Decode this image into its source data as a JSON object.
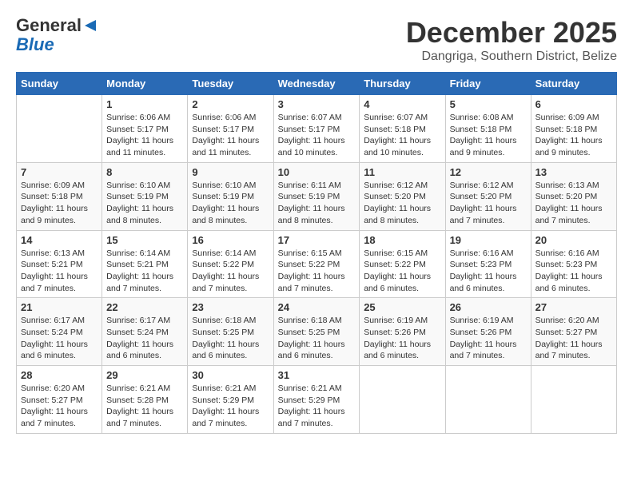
{
  "header": {
    "logo_general": "General",
    "logo_blue": "Blue",
    "month_title": "December 2025",
    "location": "Dangriga, Southern District, Belize"
  },
  "days_of_week": [
    "Sunday",
    "Monday",
    "Tuesday",
    "Wednesday",
    "Thursday",
    "Friday",
    "Saturday"
  ],
  "weeks": [
    [
      {
        "day": "",
        "sunrise": "",
        "sunset": "",
        "daylight": ""
      },
      {
        "day": "1",
        "sunrise": "Sunrise: 6:06 AM",
        "sunset": "Sunset: 5:17 PM",
        "daylight": "Daylight: 11 hours and 11 minutes."
      },
      {
        "day": "2",
        "sunrise": "Sunrise: 6:06 AM",
        "sunset": "Sunset: 5:17 PM",
        "daylight": "Daylight: 11 hours and 11 minutes."
      },
      {
        "day": "3",
        "sunrise": "Sunrise: 6:07 AM",
        "sunset": "Sunset: 5:17 PM",
        "daylight": "Daylight: 11 hours and 10 minutes."
      },
      {
        "day": "4",
        "sunrise": "Sunrise: 6:07 AM",
        "sunset": "Sunset: 5:18 PM",
        "daylight": "Daylight: 11 hours and 10 minutes."
      },
      {
        "day": "5",
        "sunrise": "Sunrise: 6:08 AM",
        "sunset": "Sunset: 5:18 PM",
        "daylight": "Daylight: 11 hours and 9 minutes."
      },
      {
        "day": "6",
        "sunrise": "Sunrise: 6:09 AM",
        "sunset": "Sunset: 5:18 PM",
        "daylight": "Daylight: 11 hours and 9 minutes."
      }
    ],
    [
      {
        "day": "7",
        "sunrise": "Sunrise: 6:09 AM",
        "sunset": "Sunset: 5:18 PM",
        "daylight": "Daylight: 11 hours and 9 minutes."
      },
      {
        "day": "8",
        "sunrise": "Sunrise: 6:10 AM",
        "sunset": "Sunset: 5:19 PM",
        "daylight": "Daylight: 11 hours and 8 minutes."
      },
      {
        "day": "9",
        "sunrise": "Sunrise: 6:10 AM",
        "sunset": "Sunset: 5:19 PM",
        "daylight": "Daylight: 11 hours and 8 minutes."
      },
      {
        "day": "10",
        "sunrise": "Sunrise: 6:11 AM",
        "sunset": "Sunset: 5:19 PM",
        "daylight": "Daylight: 11 hours and 8 minutes."
      },
      {
        "day": "11",
        "sunrise": "Sunrise: 6:12 AM",
        "sunset": "Sunset: 5:20 PM",
        "daylight": "Daylight: 11 hours and 8 minutes."
      },
      {
        "day": "12",
        "sunrise": "Sunrise: 6:12 AM",
        "sunset": "Sunset: 5:20 PM",
        "daylight": "Daylight: 11 hours and 7 minutes."
      },
      {
        "day": "13",
        "sunrise": "Sunrise: 6:13 AM",
        "sunset": "Sunset: 5:20 PM",
        "daylight": "Daylight: 11 hours and 7 minutes."
      }
    ],
    [
      {
        "day": "14",
        "sunrise": "Sunrise: 6:13 AM",
        "sunset": "Sunset: 5:21 PM",
        "daylight": "Daylight: 11 hours and 7 minutes."
      },
      {
        "day": "15",
        "sunrise": "Sunrise: 6:14 AM",
        "sunset": "Sunset: 5:21 PM",
        "daylight": "Daylight: 11 hours and 7 minutes."
      },
      {
        "day": "16",
        "sunrise": "Sunrise: 6:14 AM",
        "sunset": "Sunset: 5:22 PM",
        "daylight": "Daylight: 11 hours and 7 minutes."
      },
      {
        "day": "17",
        "sunrise": "Sunrise: 6:15 AM",
        "sunset": "Sunset: 5:22 PM",
        "daylight": "Daylight: 11 hours and 7 minutes."
      },
      {
        "day": "18",
        "sunrise": "Sunrise: 6:15 AM",
        "sunset": "Sunset: 5:22 PM",
        "daylight": "Daylight: 11 hours and 6 minutes."
      },
      {
        "day": "19",
        "sunrise": "Sunrise: 6:16 AM",
        "sunset": "Sunset: 5:23 PM",
        "daylight": "Daylight: 11 hours and 6 minutes."
      },
      {
        "day": "20",
        "sunrise": "Sunrise: 6:16 AM",
        "sunset": "Sunset: 5:23 PM",
        "daylight": "Daylight: 11 hours and 6 minutes."
      }
    ],
    [
      {
        "day": "21",
        "sunrise": "Sunrise: 6:17 AM",
        "sunset": "Sunset: 5:24 PM",
        "daylight": "Daylight: 11 hours and 6 minutes."
      },
      {
        "day": "22",
        "sunrise": "Sunrise: 6:17 AM",
        "sunset": "Sunset: 5:24 PM",
        "daylight": "Daylight: 11 hours and 6 minutes."
      },
      {
        "day": "23",
        "sunrise": "Sunrise: 6:18 AM",
        "sunset": "Sunset: 5:25 PM",
        "daylight": "Daylight: 11 hours and 6 minutes."
      },
      {
        "day": "24",
        "sunrise": "Sunrise: 6:18 AM",
        "sunset": "Sunset: 5:25 PM",
        "daylight": "Daylight: 11 hours and 6 minutes."
      },
      {
        "day": "25",
        "sunrise": "Sunrise: 6:19 AM",
        "sunset": "Sunset: 5:26 PM",
        "daylight": "Daylight: 11 hours and 6 minutes."
      },
      {
        "day": "26",
        "sunrise": "Sunrise: 6:19 AM",
        "sunset": "Sunset: 5:26 PM",
        "daylight": "Daylight: 11 hours and 7 minutes."
      },
      {
        "day": "27",
        "sunrise": "Sunrise: 6:20 AM",
        "sunset": "Sunset: 5:27 PM",
        "daylight": "Daylight: 11 hours and 7 minutes."
      }
    ],
    [
      {
        "day": "28",
        "sunrise": "Sunrise: 6:20 AM",
        "sunset": "Sunset: 5:27 PM",
        "daylight": "Daylight: 11 hours and 7 minutes."
      },
      {
        "day": "29",
        "sunrise": "Sunrise: 6:21 AM",
        "sunset": "Sunset: 5:28 PM",
        "daylight": "Daylight: 11 hours and 7 minutes."
      },
      {
        "day": "30",
        "sunrise": "Sunrise: 6:21 AM",
        "sunset": "Sunset: 5:29 PM",
        "daylight": "Daylight: 11 hours and 7 minutes."
      },
      {
        "day": "31",
        "sunrise": "Sunrise: 6:21 AM",
        "sunset": "Sunset: 5:29 PM",
        "daylight": "Daylight: 11 hours and 7 minutes."
      },
      {
        "day": "",
        "sunrise": "",
        "sunset": "",
        "daylight": ""
      },
      {
        "day": "",
        "sunrise": "",
        "sunset": "",
        "daylight": ""
      },
      {
        "day": "",
        "sunrise": "",
        "sunset": "",
        "daylight": ""
      }
    ]
  ]
}
